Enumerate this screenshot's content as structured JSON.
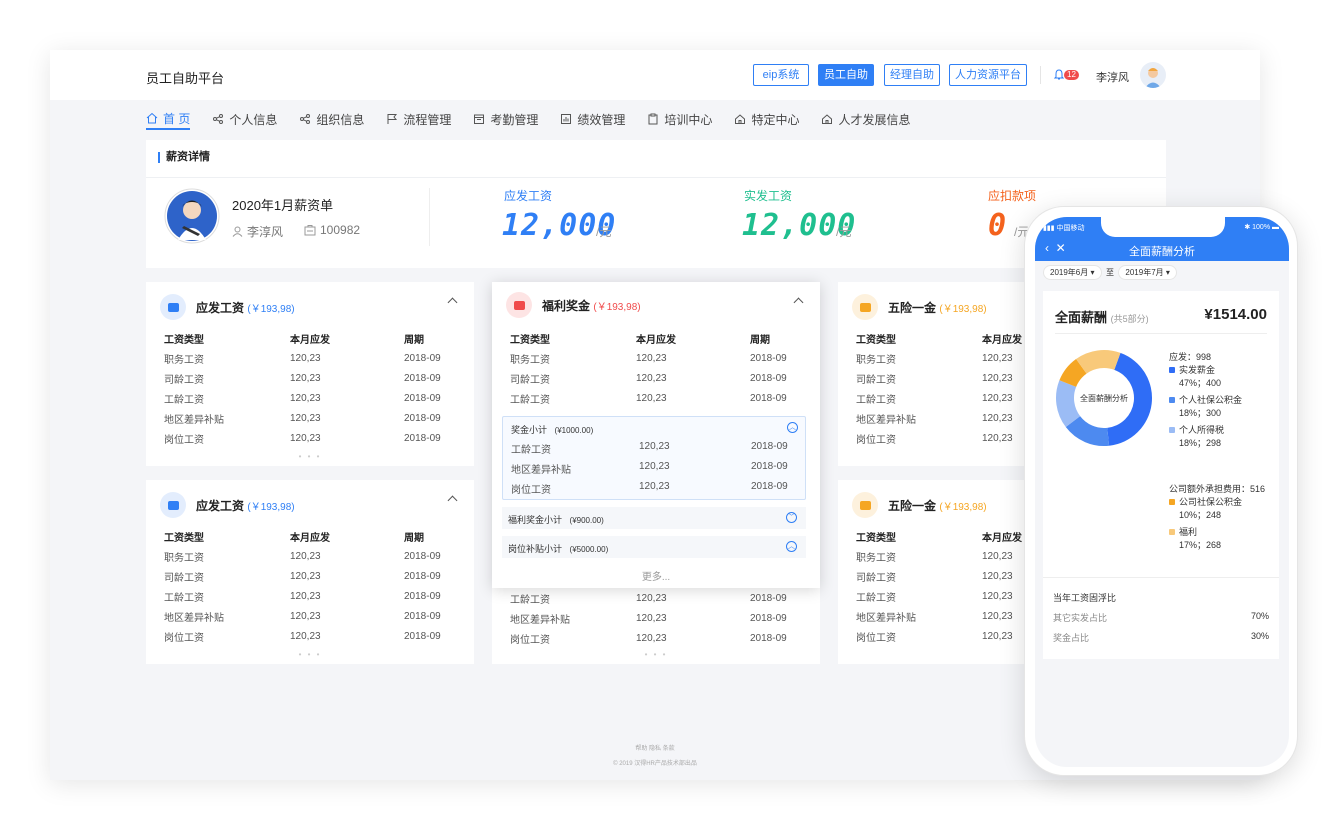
{
  "app": {
    "brand": "员工自助平台",
    "buttons": [
      "eip系统",
      "员工自助",
      "经理自助",
      "人力资源平台"
    ],
    "badge": "12",
    "username": "李淳风"
  },
  "nav": [
    "首 页",
    "个人信息",
    "组织信息",
    "流程管理",
    "考勤管理",
    "绩效管理",
    "培训中心",
    "特定中心",
    "人才发展信息"
  ],
  "salary": {
    "section_title": "薪资详情",
    "month_title": "2020年1月薪资单",
    "name": "李淳风",
    "id": "100982",
    "stats": [
      {
        "label": "应发工资",
        "value": "12,000",
        "unit": "/元",
        "color": "#2f7ff5"
      },
      {
        "label": "实发工资",
        "value": "12,000",
        "unit": "/元",
        "color": "#1fbf8f"
      },
      {
        "label": "应扣款项",
        "value": "0",
        "unit": "/元",
        "color": "#f4621d"
      }
    ]
  },
  "table": {
    "headers": [
      "工资类型",
      "本月应发",
      "周期"
    ],
    "rows": [
      [
        "职务工资",
        "120,23",
        "2018-09"
      ],
      [
        "司龄工资",
        "120,23",
        "2018-09"
      ],
      [
        "工龄工资",
        "120,23",
        "2018-09"
      ],
      [
        "地区差异补贴",
        "120,23",
        "2018-09"
      ],
      [
        "岗位工资",
        "120,23",
        "2018-09"
      ]
    ]
  },
  "cards": {
    "c1": {
      "title": "应发工资",
      "amount": "(￥193,98)",
      "color": "#2f7ff5"
    },
    "c2": {
      "title": "应发工资",
      "amount": "(￥193,98)",
      "color": "#2f7ff5"
    },
    "c3": {
      "title": "五险一金",
      "amount": "(￥193,98)",
      "color": "#f5a623"
    },
    "c4": {
      "title": "五险一金",
      "amount": "(￥193,98)",
      "color": "#f5a623"
    },
    "popup": {
      "title": "福利奖金",
      "amount": "(￥193,98)",
      "color": "#f04b4b"
    }
  },
  "popup": {
    "sub1": {
      "label": "奖金小计",
      "amount": "(¥1000.00)"
    },
    "sub1_rows": [
      [
        "工龄工资",
        "120,23",
        "2018-09"
      ],
      [
        "地区差异补贴",
        "120,23",
        "2018-09"
      ],
      [
        "岗位工资",
        "120,23",
        "2018-09"
      ]
    ],
    "sub2": {
      "label": "福利奖金小计",
      "amount": "(¥900.00)"
    },
    "sub3": {
      "label": "岗位补贴小计",
      "amount": "(¥5000.00)"
    },
    "more": "更多..."
  },
  "lower_visible_rows": [
    [
      "工龄工资",
      "120,23",
      "2018-09"
    ],
    [
      "地区差异补贴",
      "120,23",
      "2018-09"
    ],
    [
      "岗位工资",
      "120,23",
      "2018-09"
    ]
  ],
  "footer": {
    "links": "帮助   隐私   条款",
    "copyright": "© 2019 汉得HR产品技术部出品"
  },
  "phone": {
    "carrier": "中国移动",
    "battery": "100%",
    "title": "全面薪酬分析",
    "from": "2019年6月",
    "to_word": "至",
    "to": "2019年7月",
    "total_label": "全面薪酬",
    "total_sub": "(共5部分)",
    "total_value": "¥1514.00",
    "donut_center": "全面薪酬分析",
    "group1": "应发：998",
    "group2": "公司额外承担费用：516",
    "items": [
      {
        "name": "实发薪金",
        "pct": "47%；400",
        "color": "#2f6df6"
      },
      {
        "name": "个人社保公积金",
        "pct": "18%；300",
        "color": "#4d8af0"
      },
      {
        "name": "个人所得税",
        "pct": "18%；298",
        "color": "#9bbcf5"
      },
      {
        "name": "公司社保公积金",
        "pct": "10%；248",
        "color": "#f5a623"
      },
      {
        "name": "福利",
        "pct": "17%；268",
        "color": "#f8c97a"
      }
    ],
    "float_title": "当年工资固浮比",
    "float_rows": [
      [
        "其它实发占比",
        "70%"
      ],
      [
        "奖金占比",
        "30%"
      ]
    ]
  }
}
